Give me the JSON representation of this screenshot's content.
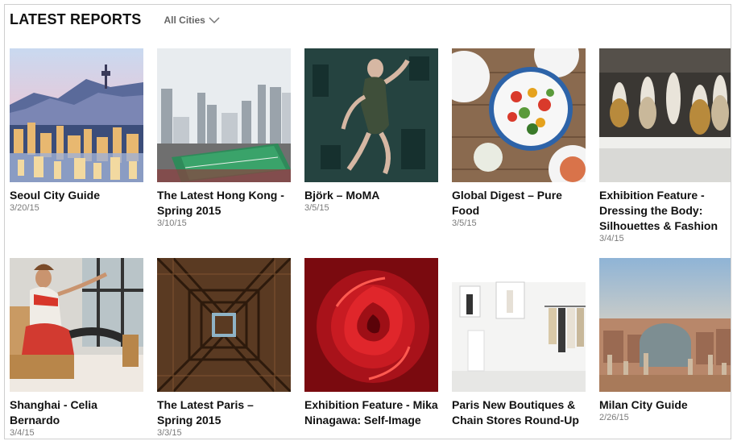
{
  "header": {
    "title": "LATEST REPORTS",
    "filter_label": "All Cities"
  },
  "reports": [
    {
      "title": "Seoul City Guide",
      "date": "3/20/15"
    },
    {
      "title": "The Latest Hong Kong - Spring 2015",
      "date": "3/10/15"
    },
    {
      "title": "Björk – MoMA",
      "date": "3/5/15"
    },
    {
      "title": "Global Digest – Pure Food",
      "date": "3/5/15"
    },
    {
      "title": "Exhibition Feature - Dressing the Body: Silhouettes & Fashion",
      "date": "3/4/15"
    },
    {
      "title": "Shanghai - Celia Bernardo",
      "date": "3/4/15"
    },
    {
      "title": "The Latest Paris – Spring 2015",
      "date": "3/3/15"
    },
    {
      "title": "Exhibition Feature - Mika Ninagawa: Self-Image",
      "date": ""
    },
    {
      "title": "Paris New Boutiques & Chain Stores Round-Up",
      "date": ""
    },
    {
      "title": "Milan City Guide",
      "date": "2/26/15"
    }
  ]
}
